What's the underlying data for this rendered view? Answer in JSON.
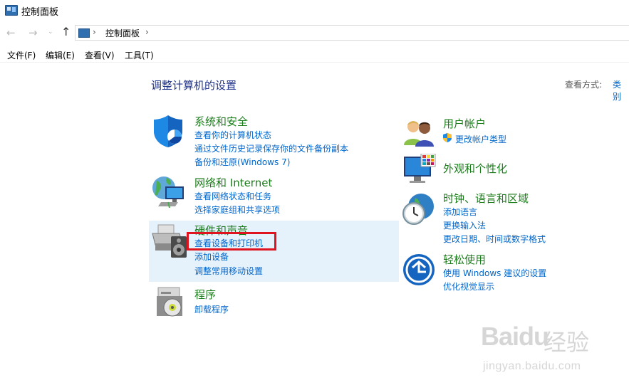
{
  "window": {
    "title": "控制面板"
  },
  "nav": {
    "back_glyph": "←",
    "forward_glyph": "→",
    "dropdown_glyph": "⌄",
    "up_glyph": "↑",
    "chevron": "›",
    "breadcrumb": "控制面板"
  },
  "menu": {
    "items": [
      {
        "label": "文件(F)"
      },
      {
        "label": "编辑(E)"
      },
      {
        "label": "查看(V)"
      },
      {
        "label": "工具(T)"
      }
    ]
  },
  "content": {
    "title": "调整计算机的设置",
    "view_by_label": "查看方式:",
    "view_by_value": "类别"
  },
  "categories": {
    "system_security": {
      "title": "系统和安全",
      "links": [
        "查看你的计算机状态",
        "通过文件历史记录保存你的文件备份副本",
        "备份和还原(Windows 7)"
      ]
    },
    "network": {
      "title": "网络和 Internet",
      "links": [
        "查看网络状态和任务",
        "选择家庭组和共享选项"
      ]
    },
    "hardware": {
      "title": "硬件和声音",
      "links": [
        "查看设备和打印机",
        "添加设备",
        "调整常用移动设置"
      ]
    },
    "programs": {
      "title": "程序",
      "links": [
        "卸载程序"
      ]
    },
    "user_accounts": {
      "title": "用户帐户",
      "links": [
        "更改帐户类型"
      ]
    },
    "appearance": {
      "title": "外观和个性化",
      "links": []
    },
    "clock_region": {
      "title": "时钟、语言和区域",
      "links": [
        "添加语言",
        "更换输入法",
        "更改日期、时间或数字格式"
      ]
    },
    "ease_of_access": {
      "title": "轻松使用",
      "links": [
        "使用 Windows 建议的设置",
        "优化视觉显示"
      ]
    }
  },
  "watermark": {
    "logo": "Baidu",
    "text": "经验",
    "url": "jingyan.baidu.com"
  },
  "colors": {
    "category_title": "#1a7d1a",
    "link": "#0066cc",
    "page_title": "#1e3287",
    "highlight_bg": "#e5f1fb",
    "annotation_box": "#e0141e"
  }
}
